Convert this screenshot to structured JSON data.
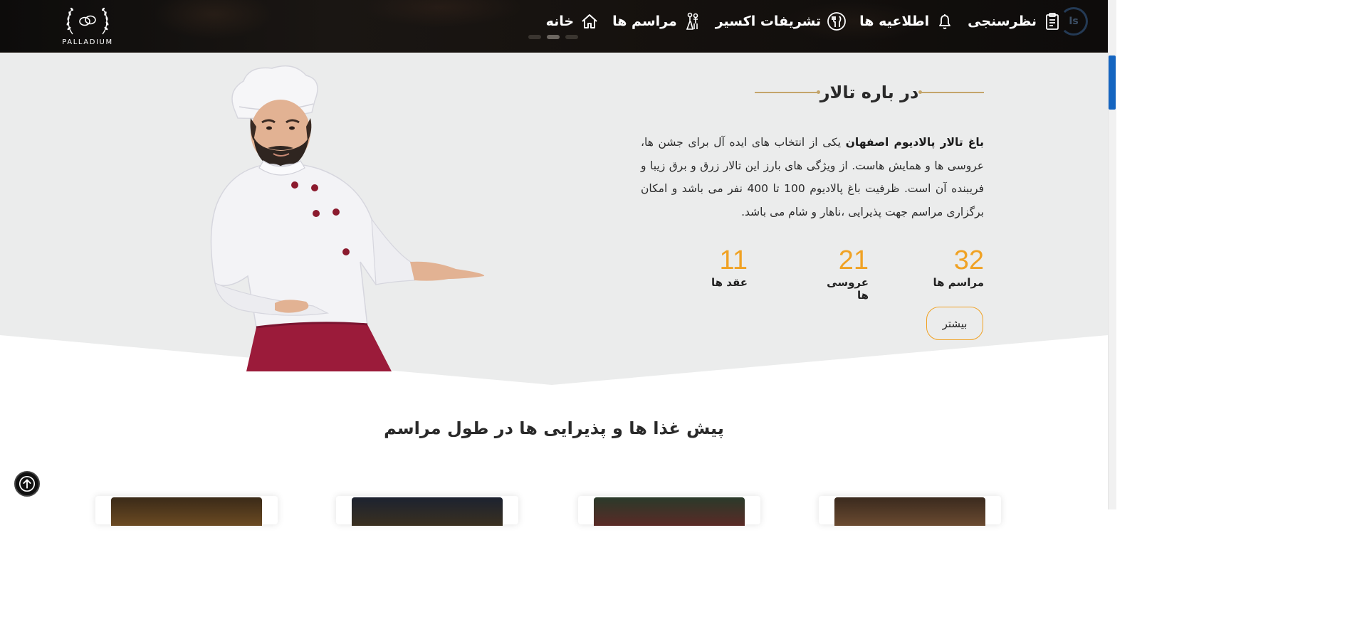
{
  "header": {
    "logo_text": "PALLADIUM",
    "nav": [
      {
        "label": "خانه",
        "icon": "home-icon"
      },
      {
        "label": "مراسم ها",
        "icon": "wedding-couple-icon"
      },
      {
        "label": "تشریفات اکسیر",
        "icon": "dining-plate-icon"
      },
      {
        "label": "اطلاعیه ها",
        "icon": "bell-icon"
      },
      {
        "label": "نظرسنجی",
        "icon": "clipboard-icon"
      }
    ],
    "loader_text": "Is"
  },
  "about": {
    "title": "در باره تالار",
    "text_bold": "باغ تالار پالادیوم اصفهان",
    "text_rest": " یکی از انتخاب های ایده آل برای جشن ها، عروسی ها و همایش هاست. از ویژگی های بارز این تالار زرق و برق زیبا و فریبنده آن است. ظرفیت باغ پالادیوم 100 تا 400 نفر می باشد و امکان برگزاری مراسم جهت پذیرایی ،ناهار و شام می باشد.",
    "stats": [
      {
        "value": "32",
        "label": "مراسم ها"
      },
      {
        "value": "21",
        "label": "عروسی ها"
      },
      {
        "value": "11",
        "label": "عقد ها"
      }
    ],
    "more_label": "بیشتر"
  },
  "appetizers": {
    "title": "پیش غذا ها و پذیرایی ها در طول مراسم"
  },
  "colors": {
    "accent": "#f0a224",
    "gold_line": "#c4a56b",
    "header_bg": "#121010",
    "section_bg": "#ebecec"
  }
}
